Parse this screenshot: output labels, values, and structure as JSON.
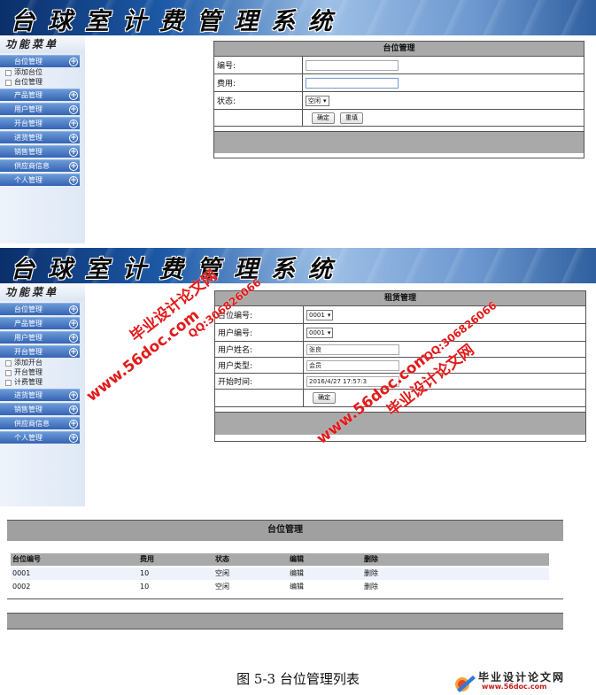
{
  "banner": {
    "title": "台球室计费管理系统"
  },
  "menu": {
    "header": "功能菜单",
    "items": [
      "台位管理",
      "产品管理",
      "用户管理",
      "开台管理",
      "进货管理",
      "销售管理",
      "供应商信息",
      "个人管理"
    ],
    "sub_table": [
      "添加台位",
      "台位管理"
    ],
    "sub_open": [
      "添加开台",
      "开台管理",
      "计费管理"
    ],
    "plus": "+"
  },
  "form1": {
    "title": "台位管理",
    "fields": [
      "编号:",
      "费用:",
      "状态:"
    ],
    "status_value": "空闲",
    "confirm": "确定",
    "reset": "重填"
  },
  "form2": {
    "title": "租赁管理",
    "fields": [
      "台位编号:",
      "用户编号:",
      "用户姓名:",
      "用户类型:",
      "开始时间:"
    ],
    "table_no": "0001",
    "user_no": "0001",
    "user_name": "张良",
    "user_type": "会员",
    "start_time": "2016/4/27 17:57:3",
    "confirm": "确定"
  },
  "watermarks": {
    "site": "www.56doc.com",
    "name": "毕业设计论文网",
    "qq": "QQ:306826066"
  },
  "list": {
    "title": "台位管理",
    "headers": [
      "台位编号",
      "费用",
      "状态",
      "编辑",
      "删除"
    ],
    "rows": [
      [
        "0001",
        "10",
        "空闲",
        "编辑",
        "删除"
      ],
      [
        "0002",
        "10",
        "空闲",
        "编辑",
        "删除"
      ]
    ]
  },
  "caption": "图 5-3 台位管理列表",
  "logo": {
    "name": "毕业设计论文网",
    "url": "www.56doc.com"
  }
}
